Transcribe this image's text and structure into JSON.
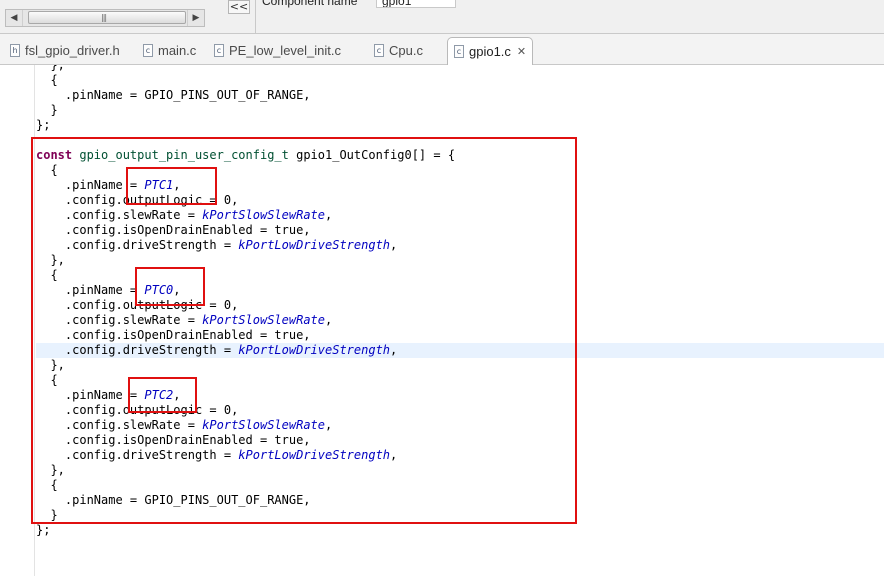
{
  "top": {
    "collapse_label": "<<",
    "component_name_label": "Component name",
    "component_name_value": "gpio1",
    "scrollbar_grip": "|||"
  },
  "tabs": [
    {
      "label": "fsl_gpio_driver.h",
      "icon": "h-file-icon",
      "active": false
    },
    {
      "label": "main.c",
      "icon": "c-file-icon",
      "active": false
    },
    {
      "label": "PE_low_level_init.c",
      "icon": "c-file-icon",
      "active": false
    },
    {
      "label": "Cpu.c",
      "icon": "c-file-icon",
      "active": false
    },
    {
      "label": "gpio1.c",
      "icon": "c-file-icon",
      "active": true
    }
  ],
  "code_lines": [
    "  },",
    "  {",
    "    .pinName = GPIO_PINS_OUT_OF_RANGE,",
    "  }",
    "};",
    "",
    "const gpio_output_pin_user_config_t gpio1_OutConfig0[] = {",
    "  {",
    "    .pinName = PTC1,",
    "    .config.outputLogic = 0,",
    "    .config.slewRate = kPortSlowSlewRate,",
    "    .config.isOpenDrainEnabled = true,",
    "    .config.driveStrength = kPortLowDriveStrength,",
    "  },",
    "  {",
    "    .pinName = PTC0,",
    "    .config.outputLogic = 0,",
    "    .config.slewRate = kPortSlowSlewRate,",
    "    .config.isOpenDrainEnabled = true,",
    "    .config.driveStrength = kPortLowDriveStrength,",
    "  },",
    "  {",
    "    .pinName = PTC2,",
    "    .config.outputLogic = 0,",
    "    .config.slewRate = kPortSlowSlewRate,",
    "    .config.isOpenDrainEnabled = true,",
    "    .config.driveStrength = kPortLowDriveStrength,",
    "  },",
    "  {",
    "    .pinName = GPIO_PINS_OUT_OF_RANGE,",
    "  }",
    "};"
  ],
  "syntax": {
    "keywords": [
      "const"
    ],
    "types": [
      "gpio_output_pin_user_config_t"
    ],
    "enums": [
      "PTC1",
      "PTC0",
      "PTC2",
      "kPortSlowSlewRate",
      "kPortLowDriveStrength"
    ]
  },
  "editor": {
    "current_line_index": 19
  },
  "colors": {
    "keyword": "#7f0055",
    "type": "#005032",
    "enum": "#0000c0",
    "annotation": "#e01010",
    "current_line": "#e8f2fe"
  }
}
